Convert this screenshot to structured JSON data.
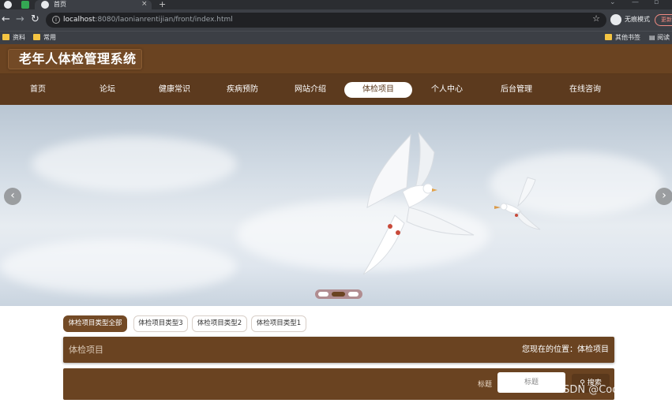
{
  "browser": {
    "tab_title": "首页",
    "tab_close": "×",
    "new_tab": "+",
    "url_host": "localhost",
    "url_path": ":8080/laonianrentijian/front/index.html",
    "incognito_label": "无痕模式",
    "update_label": "更新",
    "bookmarks": [
      "资料",
      "常用"
    ],
    "other_bookmarks": "其他书签",
    "reading_list": "阅读"
  },
  "site": {
    "title": "老年人体检管理系统",
    "nav": [
      "首页",
      "论坛",
      "健康常识",
      "疾病预防",
      "网站介绍",
      "体检项目",
      "个人中心",
      "后台管理",
      "在线咨询"
    ],
    "active_nav": "体检项目"
  },
  "banner": {
    "prev": "‹",
    "next": "›",
    "slide_count": 3,
    "active_slide": 2
  },
  "categories": {
    "tabs": [
      "体检项目类型全部",
      "体检项目类型3",
      "体检项目类型2",
      "体检项目类型1"
    ],
    "active": "体检项目类型全部"
  },
  "section": {
    "title": "体检项目",
    "breadcrumb": "您现在的位置：体检项目"
  },
  "search": {
    "label": "标题",
    "placeholder": "标题",
    "button": "搜索"
  },
  "watermark": "CSDN @Coder-coco",
  "colors": {
    "header_brown": "#6a4321",
    "nav_brown": "#5c3a1e",
    "accent_brown": "#734a26"
  }
}
